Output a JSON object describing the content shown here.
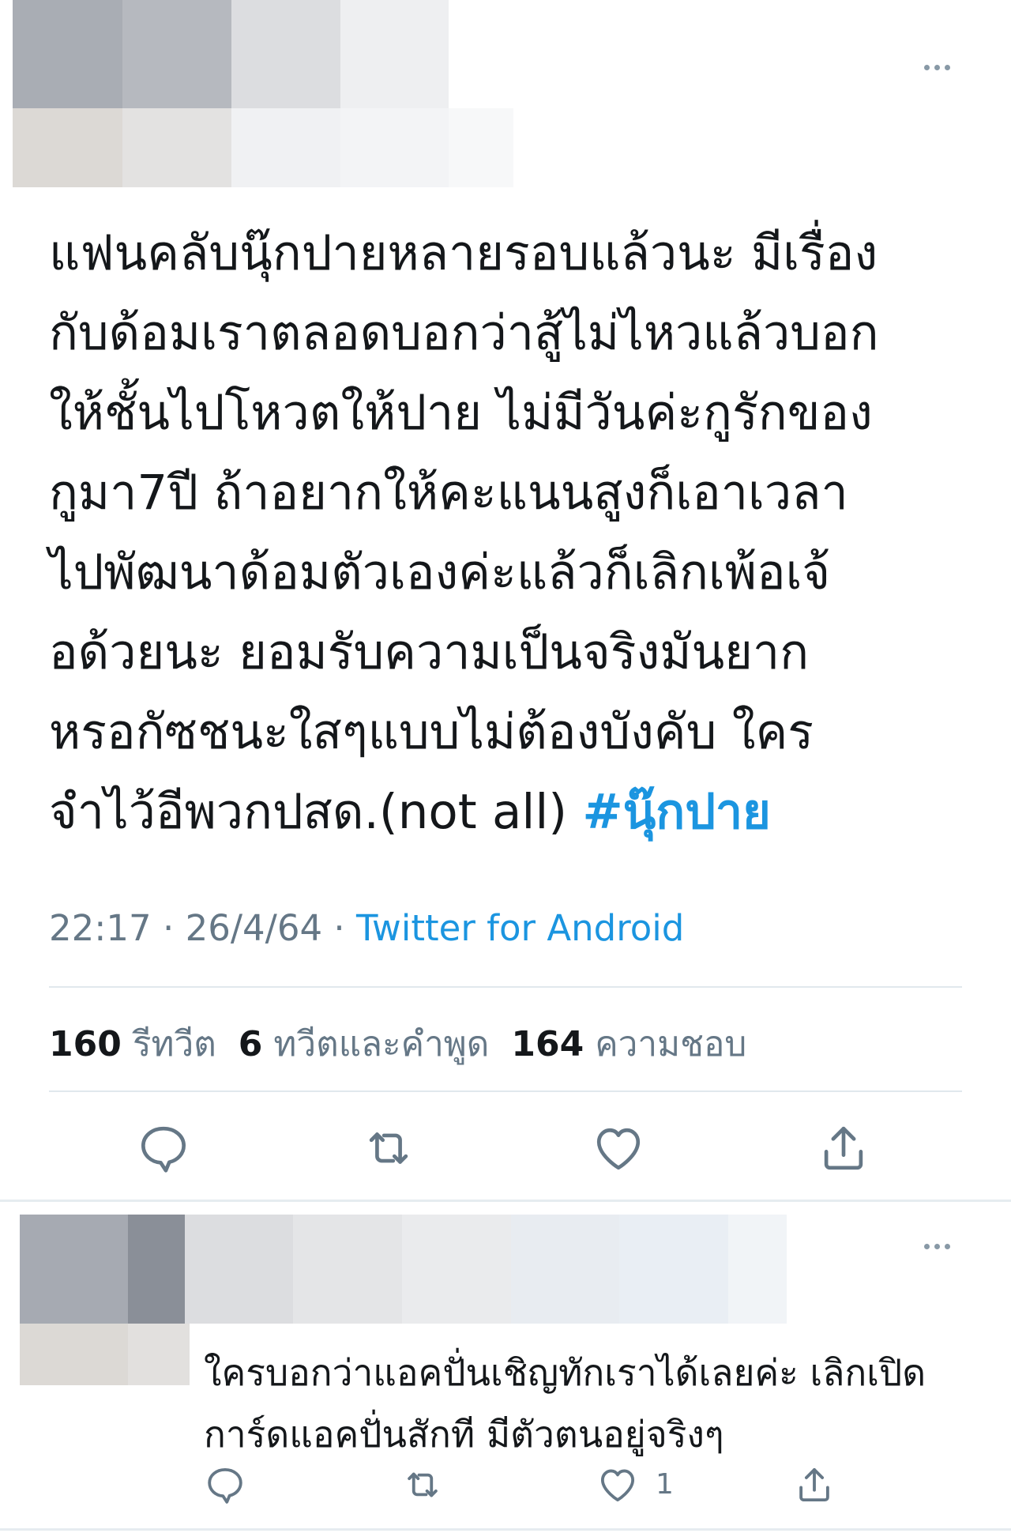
{
  "main_tweet": {
    "text": "แฟนคลับนุ๊กปายหลายรอบแล้วนะ มีเรื่อง\nกับด้อมเราตลอดบอกว่าสู้ไม่ไหวแล้วบอก\nให้ชั้นไปโหวตให้ปาย ไม่มีวันค่ะกูรักของ\nกูมา7ปี ถ้าอยากให้คะแนนสูงก็เอาเวลา\nไปพัฒนาด้อมตัวเองค่ะแล้วก็เลิกเพ้อเจ้\nอด้วยนะ ยอมรับความเป็นจริงมันยาก\nหรอกัซชนะใสๆแบบไม่ต้องบังคับ ใคร\nจำไว้อีพวกปสด.(not all) ",
    "hashtag": "#นุ๊กปาย",
    "time": "22:17",
    "separator": " · ",
    "date": "26/4/64",
    "source": "Twitter for Android",
    "retweets_count": "160",
    "retweets_label": "รีทวีต",
    "quotes_count": "6",
    "quotes_label": "ทวีตและคำพูด",
    "likes_count": "164",
    "likes_label": "ความชอบ"
  },
  "reply_tweet": {
    "text": "ใครบอกว่าแอคปั่นเชิญทักเราได้เลยค่ะ เลิกเปิด\nการ์ดแอคปั่นสักที มีตัวตนอยู่จริงๆ",
    "likes_count": "1"
  },
  "icons": {
    "reply": "speech-bubble-icon",
    "retweet": "retweet-arrows-icon",
    "like": "heart-icon",
    "share": "share-upload-icon",
    "more": "more-dots-icon"
  },
  "colors": {
    "text": "#14171a",
    "secondary": "#657786",
    "accent": "#1b95e0",
    "divider": "#e1e8ed"
  }
}
